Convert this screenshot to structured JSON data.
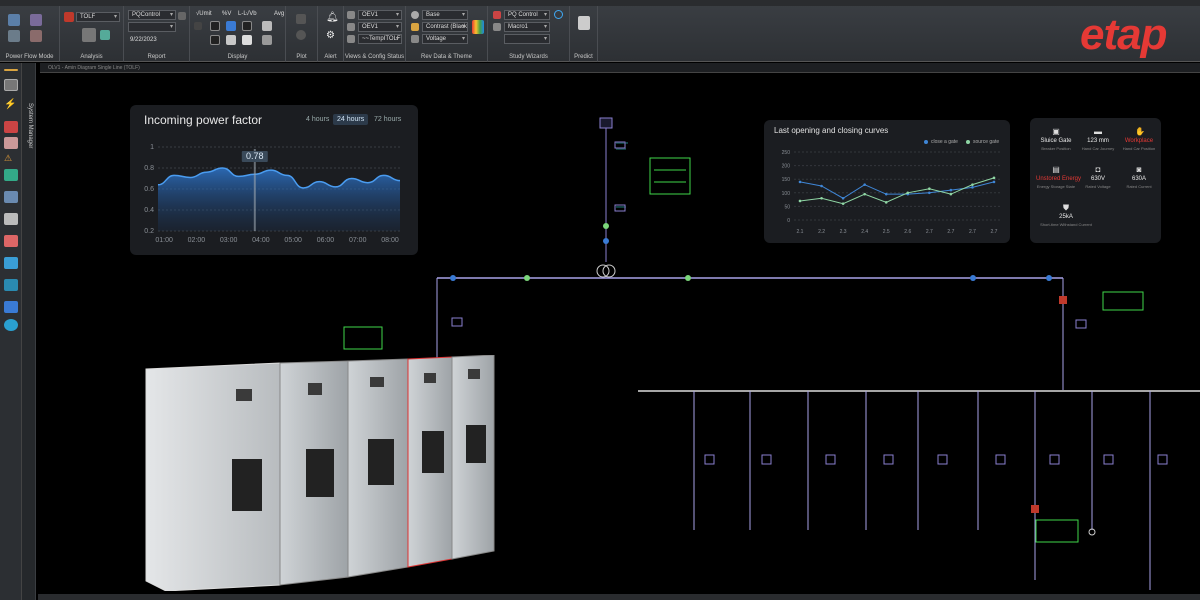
{
  "ribbon": {
    "groups": [
      {
        "label": "Power Flow Mode"
      },
      {
        "label": "Analysis"
      },
      {
        "label": "Report"
      },
      {
        "label": "Display"
      },
      {
        "label": "Plot"
      },
      {
        "label": "Alert"
      },
      {
        "label": "Views & Config Status"
      },
      {
        "label": "Rev Data & Theme"
      },
      {
        "label": "Study Wizards"
      },
      {
        "label": "Predict"
      }
    ],
    "analysis_select": "TOLF",
    "report_select": "PQControl",
    "report_date": "9/22/2023",
    "display_labels": [
      "√Umit",
      "%V",
      "√Vb",
      "Avg",
      "L-L"
    ],
    "views_selects": [
      "OEV1",
      "OEV1",
      "~~TempITOLF"
    ],
    "theme_selects": [
      "Base",
      "Contrast (Black",
      "Voltage"
    ],
    "wizard_selects": [
      "PQ Control",
      "Macro1",
      ""
    ],
    "logo": "etap",
    "brand_color": "#e53935"
  },
  "doc_bar": {
    "path": "OLV1 - Amin Diagram Single Line (TOLF)"
  },
  "system_manager": {
    "label": "System Manager"
  },
  "pf_card": {
    "title": "Incoming power factor",
    "tabs": [
      "4 hours",
      "24 hours",
      "72 hours"
    ],
    "active_tab": "24 hours",
    "marker_value": "0.78"
  },
  "curves_card": {
    "title": "Last opening and closing curves",
    "legend": [
      "close a gate",
      "source gate"
    ]
  },
  "info_card": {
    "items": [
      {
        "icon": "gate-icon",
        "value": "Sluice Gate",
        "sub": "Breaker Position",
        "red": false
      },
      {
        "icon": "gauge-icon",
        "value": "123 mm",
        "sub": "Hand Car Journey",
        "red": false
      },
      {
        "icon": "hand-icon",
        "value": "Workplace",
        "sub": "Hand Car Position",
        "red": true
      },
      {
        "icon": "battery-icon",
        "value": "Unstored Energy",
        "sub": "Energy Storage State",
        "red": true
      },
      {
        "icon": "plug-icon",
        "value": "630V",
        "sub": "Rated Voltage",
        "red": false
      },
      {
        "icon": "current-icon",
        "value": "630A",
        "sub": "Rated Current",
        "red": false
      },
      {
        "icon": "shield-icon",
        "value": "25kA",
        "sub": "Short-time Withstand Current",
        "red": false
      }
    ]
  },
  "chart_data": [
    {
      "type": "area",
      "title": "Incoming power factor",
      "categories": [
        "01:00",
        "02:00",
        "03:00",
        "04:00",
        "05:00",
        "06:00",
        "07:00",
        "08:00"
      ],
      "y_ticks": [
        "1",
        "0.8",
        "0.6",
        "0.4",
        "0.2"
      ],
      "ylim": [
        0.2,
        1.0
      ],
      "x": [
        0.5,
        1.0,
        1.5,
        2.0,
        2.5,
        3.0,
        3.5,
        4.0,
        4.5,
        5.0,
        5.5,
        6.0,
        6.5,
        7.0,
        7.5,
        8.0
      ],
      "values": [
        0.64,
        0.73,
        0.71,
        0.76,
        0.8,
        0.72,
        0.74,
        0.78,
        0.73,
        0.61,
        0.67,
        0.62,
        0.7,
        0.66,
        0.73,
        0.68
      ],
      "grid": true
    },
    {
      "type": "line",
      "title": "Last opening and closing curves",
      "categories": [
        "2.1",
        "2.2",
        "2.3",
        "2.4",
        "2.5",
        "2.6",
        "2.7",
        "2.7",
        "2.7",
        "2.7"
      ],
      "y_ticks": [
        "250",
        "200",
        "150",
        "100",
        "50",
        "0"
      ],
      "ylim": [
        0,
        250
      ],
      "series": [
        {
          "name": "close a gate",
          "values": [
            140,
            125,
            80,
            130,
            95,
            95,
            100,
            110,
            120,
            140
          ],
          "color": "#3f86d6"
        },
        {
          "name": "source gate",
          "values": [
            70,
            80,
            60,
            95,
            65,
            100,
            115,
            95,
            130,
            155
          ],
          "color": "#8fd6a4"
        }
      ],
      "grid": true
    }
  ]
}
